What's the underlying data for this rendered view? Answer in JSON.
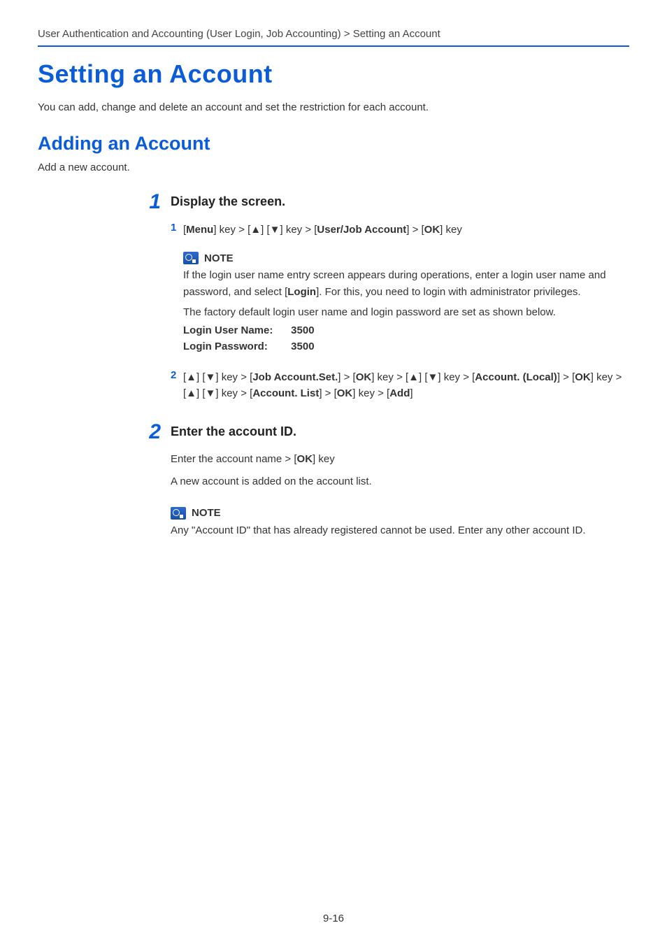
{
  "breadcrumb": "User Authentication and Accounting (User Login, Job Accounting) > Setting an Account",
  "h1": "Setting an Account",
  "intro": "You can add, change and delete an account and set the restriction for each account.",
  "h2": "Adding an Account",
  "sub": "Add a new account.",
  "step1": {
    "num": "1",
    "title": "Display the screen.",
    "sub1": {
      "num": "1",
      "pre1": "[",
      "b1": "Menu",
      "mid1": "] key > [▲] [▼] key > [",
      "b2": "User/Job Account",
      "mid2": "] > [",
      "b3": "OK",
      "post": "] key"
    },
    "note": {
      "label": "NOTE",
      "p1a": "If the login user name entry screen appears during operations, enter a login user name and password, and select [",
      "p1b": "Login",
      "p1c": "]. For this, you need to login with administrator privileges.",
      "p2": "The factory default login user name and login password are set as shown below.",
      "userLabel": "Login User Name:",
      "userVal": "3500",
      "passLabel": "Login Password:",
      "passVal": "3500"
    },
    "sub2": {
      "num": "2",
      "t1": "[▲] [▼] key > [",
      "b1": "Job Account.Set.",
      "t2": "] > [",
      "b2": "OK",
      "t3": "] key > [▲] [▼] key > [",
      "b3": "Account. (Local)",
      "t4": "] > [",
      "b4": "OK",
      "t5": "] key > [▲] [▼] key > [",
      "b5": "Account. List",
      "t6": "] > [",
      "b6": "OK",
      "t7": "] key > [",
      "b7": "Add",
      "t8": "]"
    }
  },
  "step2": {
    "num": "2",
    "title": "Enter the account ID.",
    "p1a": "Enter the account name > [",
    "p1b": "OK",
    "p1c": "] key",
    "p2": "A new account is added on the account list.",
    "note": {
      "label": "NOTE",
      "text": "Any \"Account ID\" that has already registered cannot be used. Enter any other account ID."
    }
  },
  "pageNum": "9-16"
}
